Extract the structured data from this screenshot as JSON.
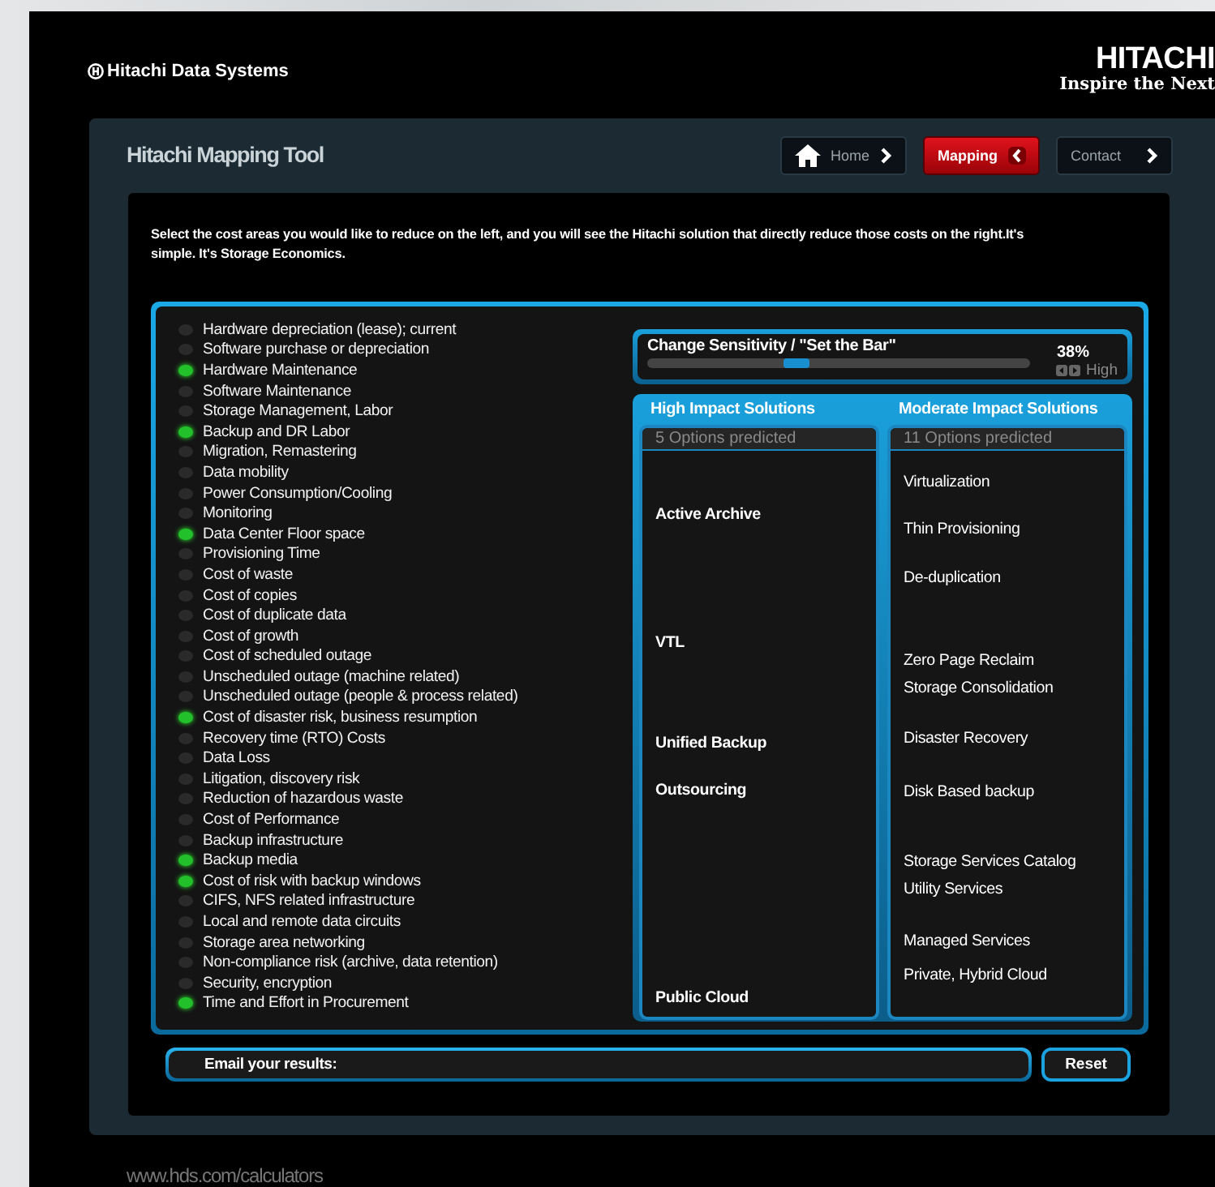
{
  "header": {
    "brand": "Hitachi Data Systems",
    "logo": "HITACHI",
    "tagline": "Inspire the Next"
  },
  "app": {
    "title": "Hitachi Mapping Tool",
    "tabs": [
      {
        "label": "Home",
        "kind": "home",
        "selected": false
      },
      {
        "label": "Mapping",
        "kind": "plain",
        "selected": true
      },
      {
        "label": "Contact",
        "kind": "plain",
        "selected": false
      }
    ],
    "intro": "Select the cost areas you would like to reduce on the left, and you will see the Hitachi solution that directly reduce those costs on the right.It's simple. It's Storage Economics.",
    "cost_areas": [
      {
        "label": "Hardware depreciation (lease); current",
        "checked": false
      },
      {
        "label": "Software purchase or depreciation",
        "checked": false
      },
      {
        "label": "Hardware Maintenance",
        "checked": true
      },
      {
        "label": "Software Maintenance",
        "checked": false
      },
      {
        "label": "Storage Management, Labor",
        "checked": false
      },
      {
        "label": "Backup and DR Labor",
        "checked": true
      },
      {
        "label": "Migration, Remastering",
        "checked": false
      },
      {
        "label": "Data mobility",
        "checked": false
      },
      {
        "label": "Power Consumption/Cooling",
        "checked": false
      },
      {
        "label": "Monitoring",
        "checked": false
      },
      {
        "label": "Data Center Floor space",
        "checked": true
      },
      {
        "label": "Provisioning Time",
        "checked": false
      },
      {
        "label": "Cost of waste",
        "checked": false
      },
      {
        "label": "Cost of copies",
        "checked": false
      },
      {
        "label": "Cost of duplicate data",
        "checked": false
      },
      {
        "label": "Cost of growth",
        "checked": false
      },
      {
        "label": "Cost of scheduled outage",
        "checked": false
      },
      {
        "label": "Unscheduled outage (machine related)",
        "checked": false
      },
      {
        "label": "Unscheduled outage (people & process related)",
        "checked": false
      },
      {
        "label": "Cost of disaster risk, business resumption",
        "checked": true
      },
      {
        "label": "Recovery time (RTO) Costs",
        "checked": false
      },
      {
        "label": "Data Loss",
        "checked": false
      },
      {
        "label": "Litigation, discovery risk",
        "checked": false
      },
      {
        "label": "Reduction of hazardous waste",
        "checked": false
      },
      {
        "label": "Cost of Performance",
        "checked": false
      },
      {
        "label": "Backup infrastructure",
        "checked": false
      },
      {
        "label": "Backup media",
        "checked": true
      },
      {
        "label": "Cost of risk with backup windows",
        "checked": true
      },
      {
        "label": "CIFS, NFS related infrastructure",
        "checked": false
      },
      {
        "label": "Local and remote data circuits",
        "checked": false
      },
      {
        "label": "Storage area networking",
        "checked": false
      },
      {
        "label": "Non-compliance risk (archive, data retention)",
        "checked": false
      },
      {
        "label": "Security, encryption",
        "checked": false
      },
      {
        "label": "Time and Effort in Procurement",
        "checked": true
      }
    ],
    "sensitivity": {
      "label": "Change Sensitivity / \"Set the Bar\"",
      "level": 0.38,
      "reading": "38%",
      "end_label": "High"
    },
    "solutions": [
      {
        "title": "High Impact Solutions",
        "count": "5 Options predicted",
        "items": [
          "Active Archive",
          "VTL",
          "Unified Backup",
          "Outsourcing",
          "Public Cloud"
        ]
      },
      {
        "title": "Moderate Impact Solutions",
        "count": "11 Options predicted",
        "items": [
          "Virtualization",
          "Thin Provisioning",
          "De-duplication",
          "Zero Page Reclaim",
          "Storage Consolidation",
          "Disaster Recovery",
          "Disk Based backup",
          "Storage Services Catalog",
          "Utility Services",
          "Managed Services",
          "Private, Hybrid Cloud"
        ]
      }
    ],
    "email": {
      "label": "Email your results:"
    },
    "reset": "Reset"
  },
  "footer": {
    "url": "www.hds.com/calculators"
  }
}
